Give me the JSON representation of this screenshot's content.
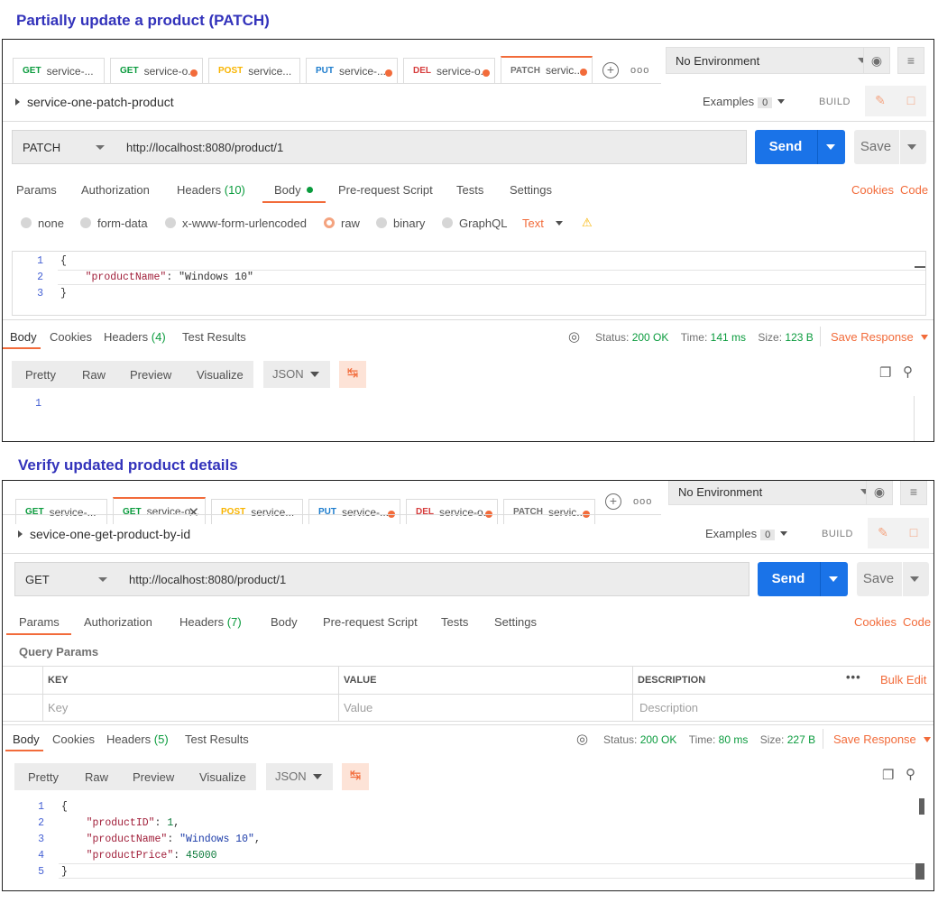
{
  "headings": {
    "patch": "Partially update a product (PATCH)",
    "get": "Verify updated product details"
  },
  "tabs": [
    {
      "method": "GET",
      "name": "service-..."
    },
    {
      "method": "GET",
      "name": "service-o..."
    },
    {
      "method": "POST",
      "name": "service..."
    },
    {
      "method": "PUT",
      "name": "service-..."
    },
    {
      "method": "DEL",
      "name": "service-o..."
    },
    {
      "method": "PATCH",
      "name": "servic..."
    }
  ],
  "common": {
    "environment": "No Environment",
    "examples_label": "Examples",
    "examples_count": "0",
    "build_label": "BUILD",
    "send_label": "Send",
    "save_label": "Save",
    "cookies_link": "Cookies",
    "code_link": "Code",
    "save_response": "Save Response",
    "response_views": [
      "Pretty",
      "Raw",
      "Preview",
      "Visualize"
    ],
    "format": "JSON",
    "request_tabs": {
      "params": "Params",
      "authorization": "Authorization",
      "headers": "Headers",
      "body": "Body",
      "prerequest": "Pre-request Script",
      "tests": "Tests",
      "settings": "Settings"
    },
    "response_tabs": {
      "body": "Body",
      "cookies": "Cookies",
      "headers": "Headers",
      "test_results": "Test Results"
    },
    "status_label": "Status:",
    "time_label": "Time:",
    "size_label": "Size:"
  },
  "patch_panel": {
    "request_name": "service-one-patch-product",
    "method": "PATCH",
    "url": "http://localhost:8080/product/1",
    "headers_count": "(10)",
    "body_types": [
      "none",
      "form-data",
      "x-www-form-urlencoded",
      "raw",
      "binary",
      "GraphQL"
    ],
    "body_selected": "raw",
    "body_format": "Text",
    "request_body_lines": [
      "1",
      "2",
      "3"
    ],
    "request_body": {
      "key": "\"productName\"",
      "value": "\"Windows 10\""
    },
    "response_headers_count": "(4)",
    "status": "200 OK",
    "time": "141 ms",
    "size": "123 B",
    "response_lines": [
      "1"
    ]
  },
  "get_panel": {
    "request_name": "sevice-one-get-product-by-id",
    "method": "GET",
    "url": "http://localhost:8080/product/1",
    "headers_count": "(7)",
    "query_params_title": "Query Params",
    "table_headers": {
      "key": "KEY",
      "value": "VALUE",
      "description": "DESCRIPTION"
    },
    "table_placeholders": {
      "key": "Key",
      "value": "Value",
      "description": "Description"
    },
    "bulk_edit": "Bulk Edit",
    "response_headers_count": "(5)",
    "status": "200 OK",
    "time": "80 ms",
    "size": "227 B",
    "response_lines": [
      "1",
      "2",
      "3",
      "4",
      "5"
    ],
    "response_body": {
      "id_key": "\"productID\"",
      "id_val": "1",
      "name_key": "\"productName\"",
      "name_val": "\"Windows 10\"",
      "price_key": "\"productPrice\"",
      "price_val": "45000"
    }
  },
  "colors": {
    "accent": "#f26b3a",
    "send_blue": "#1a73e8",
    "ok_green": "#0a9b3d",
    "heading_blue": "#3333bb"
  },
  "icons": [
    "eye-icon",
    "sliders-icon",
    "plus-circle-icon",
    "more-icon",
    "edit-icon",
    "comment-icon",
    "globe-icon",
    "wrap-icon",
    "copy-icon",
    "search-icon",
    "warning-icon",
    "close-icon"
  ]
}
